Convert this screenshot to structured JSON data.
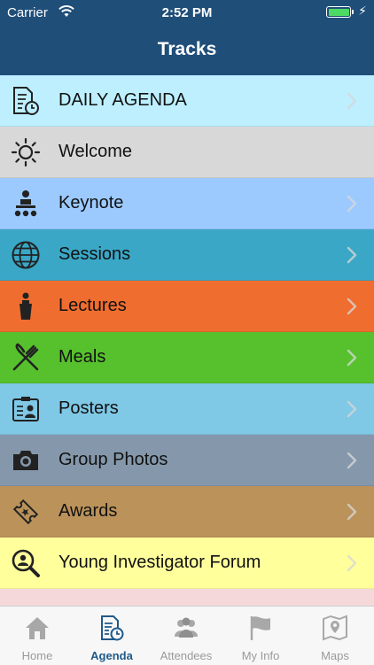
{
  "status_bar": {
    "carrier": "Carrier",
    "time": "2:52 PM",
    "battery_level": 1.0
  },
  "nav": {
    "title": "Tracks"
  },
  "accent_color": "#1f4e79",
  "tracks": [
    {
      "label": "DAILY AGENDA",
      "icon": "daily-agenda-icon",
      "color": "#bdefff"
    },
    {
      "label": "Welcome",
      "icon": "sun-icon",
      "color": "#d8d8d8"
    },
    {
      "label": "Keynote",
      "icon": "presenter-icon",
      "color": "#9ccaff"
    },
    {
      "label": "Sessions",
      "icon": "globe-icon",
      "color": "#3aa7c6"
    },
    {
      "label": "Lectures",
      "icon": "podium-icon",
      "color": "#ef6d2f"
    },
    {
      "label": "Meals",
      "icon": "fork-knife-icon",
      "color": "#57c12d"
    },
    {
      "label": "Posters",
      "icon": "poster-board-icon",
      "color": "#7fc8e6"
    },
    {
      "label": "Group Photos",
      "icon": "camera-icon",
      "color": "#8598ab"
    },
    {
      "label": "Awards",
      "icon": "ticket-icon",
      "color": "#ba925a"
    },
    {
      "label": "Young Investigator Forum",
      "icon": "magnifier-person-icon",
      "color": "#ffff9c"
    },
    {
      "label": "",
      "icon": "partial-row-icon",
      "color": "#f4d8da"
    }
  ],
  "tabs": [
    {
      "label": "Home",
      "icon": "home-icon",
      "active": false
    },
    {
      "label": "Agenda",
      "icon": "agenda-icon",
      "active": true
    },
    {
      "label": "Attendees",
      "icon": "attendees-icon",
      "active": false
    },
    {
      "label": "My Info",
      "icon": "flag-icon",
      "active": false
    },
    {
      "label": "Maps",
      "icon": "map-icon",
      "active": false
    }
  ]
}
